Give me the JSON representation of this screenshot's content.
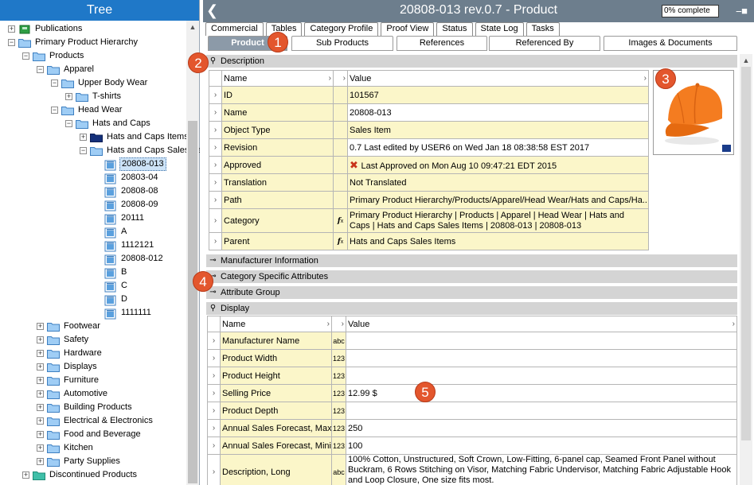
{
  "tree": {
    "title": "Tree",
    "items": [
      {
        "label": "Publications",
        "icon": "green-box-icon"
      },
      {
        "label": "Primary Product Hierarchy",
        "icon": "folder-icon"
      },
      {
        "label": "Products",
        "icon": "folder-icon"
      },
      {
        "label": "Apparel",
        "icon": "folder-icon"
      },
      {
        "label": "Upper Body Wear",
        "icon": "folder-icon"
      },
      {
        "label": "T-shirts",
        "icon": "folder-icon"
      },
      {
        "label": "Head Wear",
        "icon": "folder-icon"
      },
      {
        "label": "Hats and Caps",
        "icon": "folder-icon"
      },
      {
        "label": "Hats and Caps Items",
        "icon": "dark-folder-icon"
      },
      {
        "label": "Hats and Caps Sales Items",
        "icon": "folder-icon"
      },
      {
        "label": "20808-013",
        "icon": "product-icon"
      },
      {
        "label": "20803-04",
        "icon": "product-icon"
      },
      {
        "label": "20808-08",
        "icon": "product-icon"
      },
      {
        "label": "20808-09",
        "icon": "product-icon"
      },
      {
        "label": "20111",
        "icon": "product-icon"
      },
      {
        "label": "A",
        "icon": "product-icon"
      },
      {
        "label": "1112121",
        "icon": "product-icon"
      },
      {
        "label": "20808-012",
        "icon": "product-icon"
      },
      {
        "label": "B",
        "icon": "product-icon"
      },
      {
        "label": "C",
        "icon": "product-icon"
      },
      {
        "label": "D",
        "icon": "product-icon"
      },
      {
        "label": "1111111",
        "icon": "product-icon"
      },
      {
        "label": "Footwear",
        "icon": "folder-icon"
      },
      {
        "label": "Safety",
        "icon": "folder-icon"
      },
      {
        "label": "Hardware",
        "icon": "folder-icon"
      },
      {
        "label": "Displays",
        "icon": "folder-icon"
      },
      {
        "label": "Furniture",
        "icon": "folder-icon"
      },
      {
        "label": "Automotive",
        "icon": "folder-icon"
      },
      {
        "label": "Building Products",
        "icon": "folder-icon"
      },
      {
        "label": "Electrical & Electronics",
        "icon": "folder-icon"
      },
      {
        "label": "Food and Beverage",
        "icon": "folder-icon"
      },
      {
        "label": "Kitchen",
        "icon": "folder-icon"
      },
      {
        "label": "Party Supplies",
        "icon": "folder-icon"
      },
      {
        "label": "Discontinued Products",
        "icon": "teal-folder-icon"
      }
    ]
  },
  "header": {
    "back_icon": "back-chevron-icon",
    "title": "20808-013 rev.0.7 - Product",
    "complete": "0% complete",
    "pin_icon": "pin-icon"
  },
  "tabs_row1": [
    "Commercial",
    "Tables",
    "Category Profile",
    "Proof View",
    "Status",
    "State Log",
    "Tasks"
  ],
  "tabs_row2": [
    "Product",
    "Sub Products",
    "References",
    "Referenced By",
    "Images & Documents"
  ],
  "description": {
    "section_label": "Description",
    "col_name": "Name",
    "col_value": "Value",
    "rows": [
      {
        "name": "ID",
        "value": "101567"
      },
      {
        "name": "Name",
        "value": "20808-013"
      },
      {
        "name": "Object Type",
        "value": "Sales Item"
      },
      {
        "name": "Revision",
        "value": "0.7 Last edited by USER6 on Wed Jan 18 08:38:58 EST 2017"
      },
      {
        "name": "Approved",
        "value": "Last Approved on Mon Aug 10 09:47:21 EDT 2015"
      },
      {
        "name": "Translation",
        "value": "Not Translated"
      },
      {
        "name": "Path",
        "value": "Primary Product Hierarchy/Products/Apparel/Head Wear/Hats and Caps/Ha..."
      },
      {
        "name": "Category",
        "value": "Primary Product Hierarchy | Products | Apparel | Head Wear | Hats and Caps | Hats and Caps Sales Items | 20808-013 | 20808-013"
      },
      {
        "name": "Parent",
        "value": "Hats and Caps Sales Items"
      }
    ]
  },
  "collapsed_sections": [
    "Manufacturer Information",
    "Category Specific Attributes",
    "Attribute Group"
  ],
  "display": {
    "section_label": "Display",
    "col_name": "Name",
    "col_value": "Value",
    "rows": [
      {
        "name": "Manufacturer Name",
        "type": "abc",
        "value": ""
      },
      {
        "name": "Product Width",
        "type": "123",
        "value": ""
      },
      {
        "name": "Product Height",
        "type": "123",
        "value": ""
      },
      {
        "name": "Selling Price",
        "type": "123",
        "value": "12.99 $"
      },
      {
        "name": "Product Depth",
        "type": "123",
        "value": ""
      },
      {
        "name": "Annual Sales Forecast, Maximum",
        "type": "123",
        "value": "250"
      },
      {
        "name": "Annual Sales Forecast, Minimum",
        "type": "123",
        "value": "100"
      },
      {
        "name": "Description, Long",
        "type": "abc",
        "value": "100% Cotton, Unstructured, Soft Crown, Low-Fitting, 6-panel cap, Seamed Front Panel without Buckram, 6 Rows Stitching on Visor, Matching Fabric Undervisor, Matching Fabric Adjustable Hook and Loop Closure, One size fits most."
      }
    ]
  },
  "callouts": [
    "1",
    "2",
    "3",
    "4",
    "5"
  ],
  "colors": {
    "tree_header": "#1f78c8",
    "main_header": "#6d7e8d",
    "row_yellow": "#fbf6c9",
    "callout": "#e3562d"
  }
}
